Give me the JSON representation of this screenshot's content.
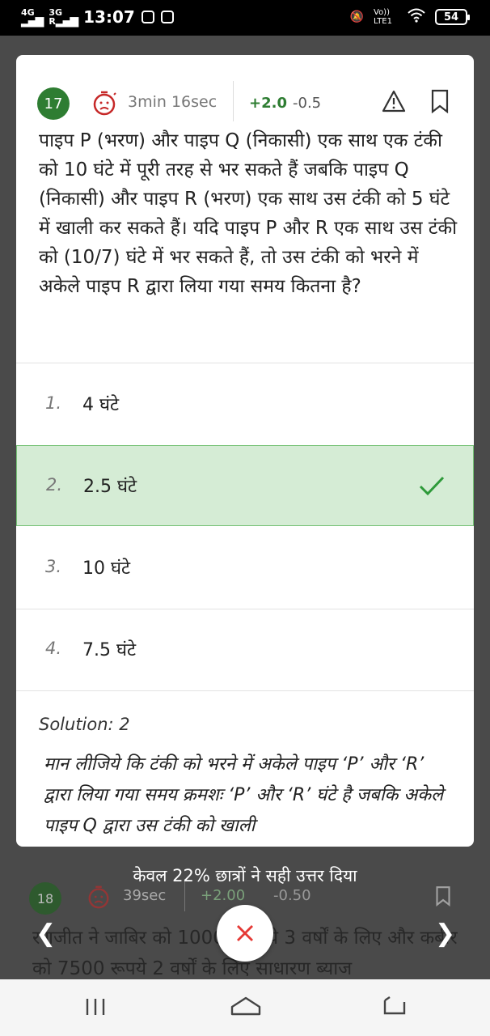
{
  "status_bar": {
    "network_1": "4G",
    "network_2": "3G",
    "network_2_sub": "R",
    "time": "13:07",
    "volte": "Vo)) LTE1",
    "battery": "54"
  },
  "question": {
    "number": "17",
    "timer": "3min 16sec",
    "marks_plus": "+2.0",
    "marks_minus": "-0.5",
    "text": "पाइप P (भरण) और पाइप Q (निकासी) एक साथ एक टंकी को 10 घंटे में पूरी तरह से भर सकते हैं जबकि पाइप Q (निकासी) और पाइप R (भरण) एक साथ उस टंकी को 5 घंटे में खाली कर सकते हैं। यदि पाइप P और R एक साथ उस टंकी को (10/7) घंटे में भर सकते हैं, तो उस टंकी को भरने में अकेले पाइप R द्वारा लिया गया समय कितना है?"
  },
  "options": [
    {
      "num": "1.",
      "text": "4 घंटे"
    },
    {
      "num": "2.",
      "text": "2.5 घंटे"
    },
    {
      "num": "3.",
      "text": "10 घंटे"
    },
    {
      "num": "4.",
      "text": "7.5 घंटे"
    }
  ],
  "correct_option": 2,
  "solution": {
    "title": "Solution: 2",
    "text": "मान लीजिये कि टंकी को भरने में अकेले पाइप ‘P’ और ‘R’ द्वारा लिया गया समय क्रमशः ‘P’ और ‘R’ घंटे है जबकि अकेले पाइप Q द्वारा उस टंकी को खाली"
  },
  "correct_percent_text": "केवल 22% छात्रों ने सही उत्तर दिया",
  "next_question": {
    "number": "18",
    "timer": "39sec",
    "marks_plus": "+2.00",
    "marks_minus": "-0.50",
    "text": "रणजीत ने जाबिर को 10000 रूपये 3 वर्षों के लिए और कबीर को 7500 रूपये 2 वर्षों के लिए साधारण ब्याज"
  },
  "colors": {
    "accent_green": "#2e7d32",
    "correct_bg": "#d5ecd5",
    "close_red": "#e53935"
  },
  "icons": [
    "timer-sad-icon",
    "warning-icon",
    "bookmark-icon",
    "check-icon",
    "chevron-left-icon",
    "chevron-right-icon",
    "close-icon",
    "menu-icon",
    "home-icon",
    "back-icon"
  ]
}
